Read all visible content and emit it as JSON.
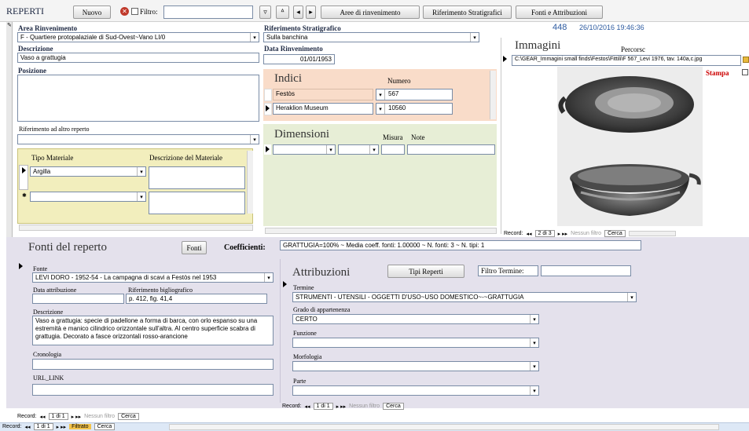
{
  "toolbar": {
    "title": "REPERTI",
    "new_label": "Nuovo",
    "filter_label": "Filtro:",
    "filter_value": "",
    "areas_button": "Aree di rinvenimento",
    "strat_button": "Riferimento Stratigrafici",
    "sources_button": "Fonti e Attribuzioni",
    "record_id": "448",
    "timestamp": "26/10/2016 19:46:36"
  },
  "form": {
    "area_label": "Area Rinvenimento",
    "area_value": "F - Quartiere protopalaziale di Sud-Ovest~Vano LI/0",
    "strat_label": "Riferimento Stratigrafico",
    "strat_value": "Sulla banchina",
    "description_label": "Descrizione",
    "description_value": "Vaso a grattugia",
    "date_label": "Data Rinvenimento",
    "date_value": "01/01/1953",
    "position_label": "Posizione",
    "position_value": "",
    "other_ref_label": "Riferimento ad altro reperto",
    "other_ref_value": ""
  },
  "materials": {
    "col1": "Tipo Materiale",
    "col2": "Descrizione del Materiale",
    "rows": [
      {
        "type": "Argilla",
        "desc": ""
      },
      {
        "type": "",
        "desc": ""
      }
    ]
  },
  "indici": {
    "title": "Indici",
    "col_number": "Numero",
    "rows": [
      {
        "name": "Festòs",
        "number": "567"
      },
      {
        "name": "Heraklion Museum",
        "number": "10560"
      }
    ]
  },
  "dimensioni": {
    "title": "Dimensioni",
    "col_measure": "Misura",
    "col_notes": "Note"
  },
  "images": {
    "title": "Immagini",
    "path_label": "Percorsc",
    "path_value": "C:\\GEAR_Immagini small finds\\Festos\\Fittili\\F 567_Levi 1976, tav. 140a,c.jpg",
    "print_label": "Stampa",
    "nav_record": "Record:",
    "nav_pos": "2 di 3",
    "nav_filter": "Nessun filtro",
    "nav_search": "Cerca"
  },
  "fonti": {
    "title": "Fonti del reperto",
    "button": "Fonti",
    "coeff_label": "Coefficienti:",
    "coeff_value": "GRATTUGIA=100% ~ Media coeff. fonti: 1.00000 ~ N. fonti: 3 ~ N. tipi: 1",
    "source_label": "Fonte",
    "source_value": "LEVI DORO - 1952-54 - La campagna di scavi a Festòs nel 1953",
    "date_attr_label": "Data attribuzione",
    "date_attr_value": "",
    "biblio_label": "Riferimento bigliografico",
    "biblio_value": "p. 412, fig. 41,4",
    "desc_label": "Descrizione",
    "desc_value": "Vaso a grattugia: specie di padellone a forma di barca, con orlo espanso su una estremità e manico cilindrico orizzontale sull'altra. Al centro superficie scabra di grattugia. Decorato a fasce orizzontali rosso-arancione",
    "chrono_label": "Cronologia",
    "chrono_value": "",
    "url_label": "URL_LINK",
    "url_value": "",
    "nav_record": "Record:",
    "nav_pos": "1 di 1",
    "nav_filter": "Nessun filtro",
    "nav_search": "Cerca"
  },
  "attribuzioni": {
    "title": "Attribuzioni",
    "types_button": "Tipi Reperti",
    "filter_label": "Filtro Termine:",
    "filter_value": "",
    "term_label": "Termine",
    "term_value": "STRUMENTI - UTENSILI - OGGETTI D'USO~USO DOMESTICO~-~GRATTUGIA",
    "grade_label": "Grado di appartenenza",
    "grade_value": "CERTO",
    "function_label": "Funzione",
    "function_value": "",
    "morph_label": "Morfologia",
    "morph_value": "",
    "part_label": "Parte",
    "part_value": "",
    "nav_record": "Record:",
    "nav_pos": "1 di 1",
    "nav_filter": "Nessun filtro",
    "nav_search": "Cerca"
  },
  "bottom_nav": {
    "record": "Record:",
    "pos": "1 di 1",
    "filter": "Filtrato",
    "search": "Cerca"
  },
  "colors": {
    "indici_bg": "#f9dcc9",
    "dim_bg": "#e7eed6",
    "material_bg": "#f2eebd",
    "lower_bg": "#e4e1ec",
    "scroll_blue": "#dde8f6"
  }
}
